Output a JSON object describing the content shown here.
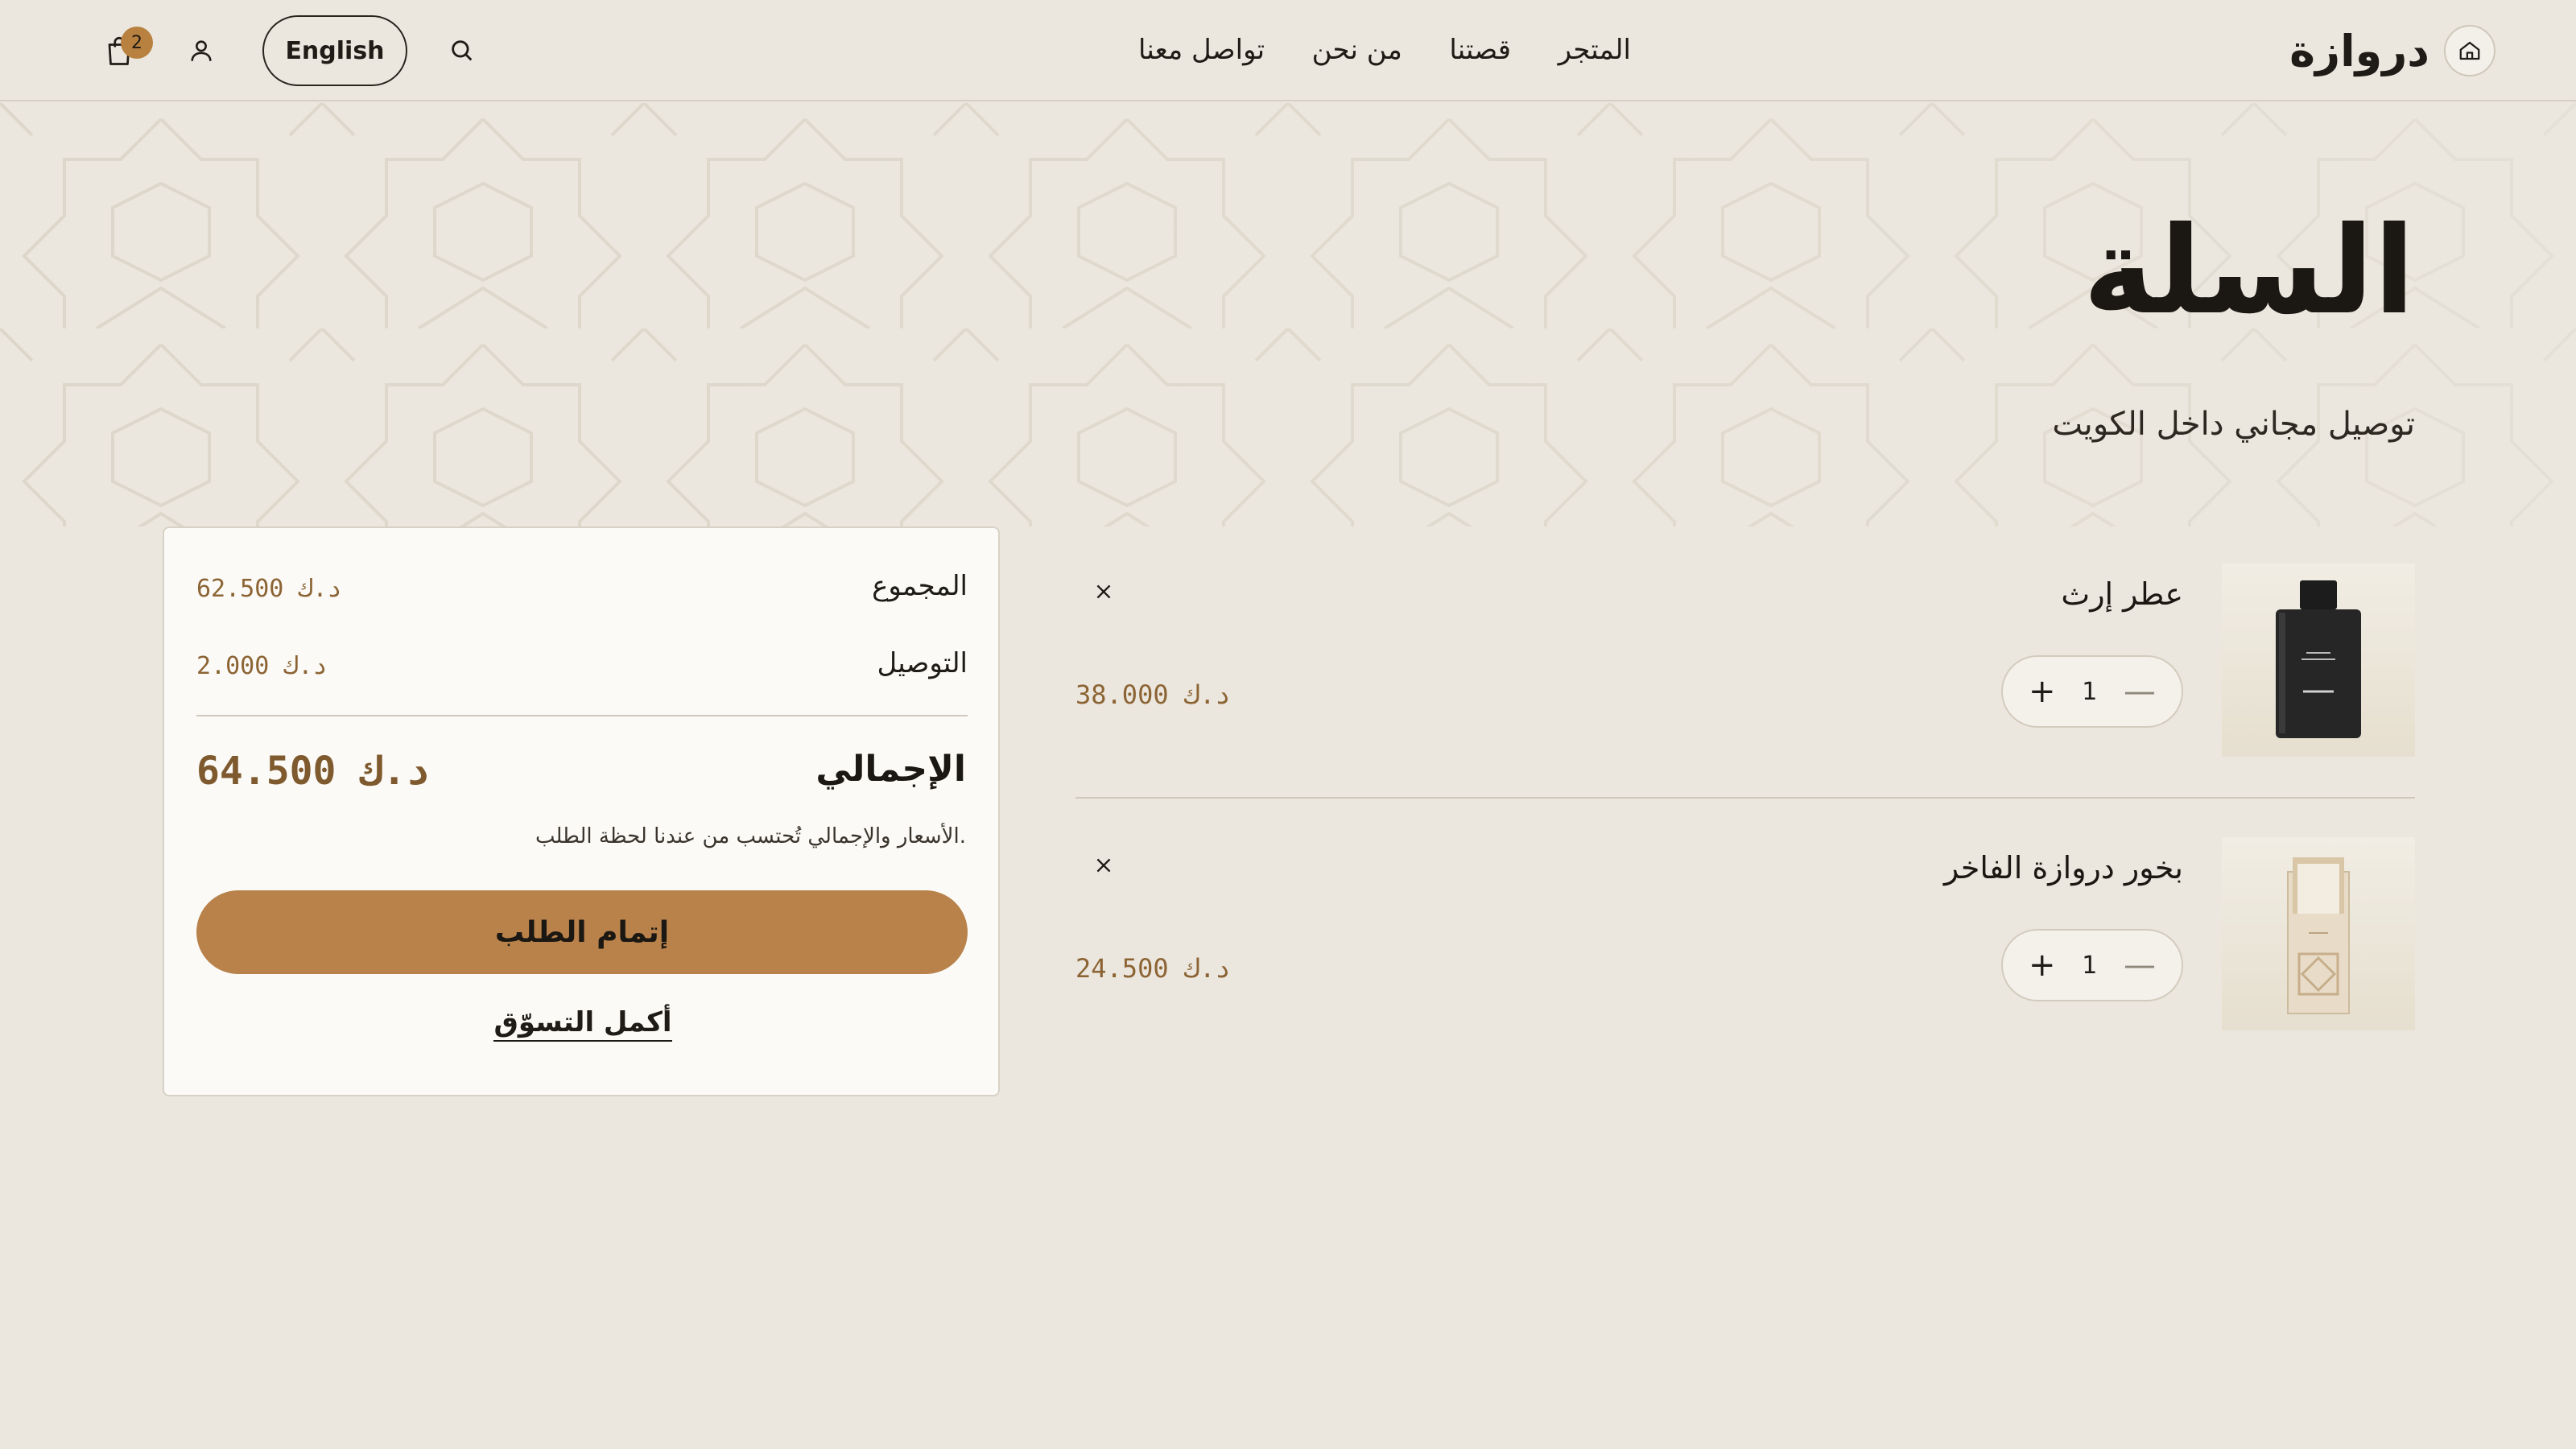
{
  "header": {
    "brand": "دروازة",
    "nav": [
      {
        "label": "المتجر"
      },
      {
        "label": "قصتنا"
      },
      {
        "label": "من نحن"
      },
      {
        "label": "تواصل معنا"
      }
    ],
    "language_button": "English",
    "cart_count": "2"
  },
  "page": {
    "title": "السلة",
    "subtitle": "توصيل مجاني داخل الكويت"
  },
  "cart": {
    "items": [
      {
        "name": "عطر إرث",
        "quantity": "1",
        "price": "38.000 د.ك",
        "qty_plus": "+",
        "qty_minus": "—"
      },
      {
        "name": "بخور دروازة الفاخر",
        "quantity": "1",
        "price": "24.500 د.ك",
        "qty_plus": "+",
        "qty_minus": "—"
      }
    ]
  },
  "summary": {
    "subtotal_label": "المجموع",
    "subtotal_value": "62.500 د.ك",
    "delivery_label": "التوصيل",
    "delivery_value": "2.000 د.ك",
    "total_label": "الإجمالي",
    "total_value": "64.500 د.ك",
    "note": "الأسعار والإجمالي تُحتسب من عندنا لحظة الطلب.",
    "checkout_label": "إتمام الطلب",
    "continue_label": "أكمل التسوّق"
  },
  "colors": {
    "background": "#ebe7de",
    "accent": "#b8824a",
    "price": "#8c6434",
    "text": "#1f1b16"
  },
  "icons": [
    "home-icon",
    "search-icon",
    "user-icon",
    "shopping-bag-icon",
    "close-icon",
    "plus-icon",
    "minus-icon"
  ]
}
